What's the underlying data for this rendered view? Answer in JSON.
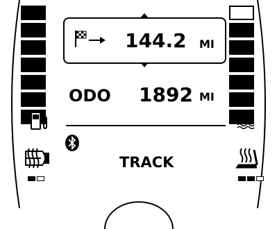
{
  "trip": {
    "value": "144.2",
    "unit": "MI"
  },
  "odometer": {
    "label": "ODO",
    "value": "1892",
    "unit": "MI"
  },
  "mode": {
    "text": "TRACK"
  },
  "fuel_gauge": {
    "filled_segments": 7,
    "total_segments": 7
  },
  "temp_gauge": {
    "filled_segments": 6,
    "total_segments": 7
  },
  "rear_defrost_level": {
    "on": 1,
    "total": 2
  },
  "seat_heat_level": {
    "on": 2,
    "total": 3
  },
  "icons": {
    "trip": "finish-flag-arrow-icon",
    "bluetooth": "bluetooth-icon",
    "fuel": "fuel-pump-icon",
    "temp": "coolant-temperature-icon",
    "rear_defrost": "rear-defrost-icon",
    "seat_heat": "heated-seat-icon"
  }
}
